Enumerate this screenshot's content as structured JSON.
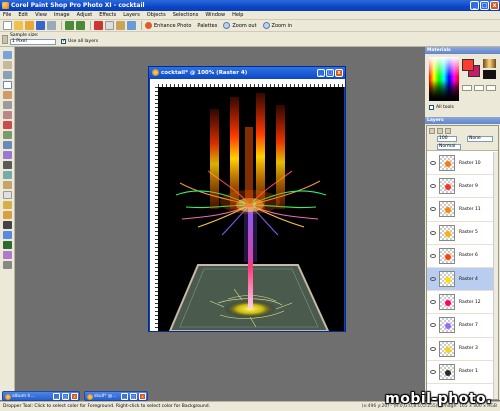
{
  "window": {
    "title": "Corel Paint Shop Pro Photo XI - cocktail",
    "min": "_",
    "max": "□",
    "close": "x"
  },
  "menu": [
    "File",
    "Edit",
    "View",
    "Image",
    "Adjust",
    "Effects",
    "Layers",
    "Objects",
    "Selections",
    "Window",
    "Help"
  ],
  "toolbar": {
    "enhance_photo": "Enhance Photo",
    "palettes": "Palettes",
    "zoom_out": "Zoom out",
    "zoom_in": "Zoom in"
  },
  "tool_options": {
    "sample_size_label": "Sample size:",
    "sample_size_value": "1 Pixel",
    "use_all_layers": "Use all layers",
    "use_all_layers_checked": true
  },
  "document": {
    "title": "cocktail* @ 100% (Raster 4)"
  },
  "materials": {
    "title": "Materials",
    "all_tools": "All tools",
    "foreground": "#ff3b2f",
    "background": "#cc1a6a"
  },
  "layers": {
    "title": "Layers",
    "opacity": "100",
    "blend_mode": "Normal",
    "none": "None",
    "items": [
      {
        "name": "Raster 10",
        "color": "#ff7a00",
        "selected": false
      },
      {
        "name": "Raster 9",
        "color": "#ff2d2d",
        "selected": false
      },
      {
        "name": "Raster 11",
        "color": "#ff8800",
        "selected": false
      },
      {
        "name": "Raster 5",
        "color": "#ffb000",
        "selected": false
      },
      {
        "name": "Raster 6",
        "color": "#ff4400",
        "selected": false
      },
      {
        "name": "Raster 4",
        "color": "#ffe000",
        "selected": true
      },
      {
        "name": "Raster 12",
        "color": "#ff0066",
        "selected": false
      },
      {
        "name": "Raster 7",
        "color": "#9966ff",
        "selected": false
      },
      {
        "name": "Raster 3",
        "color": "#ffd400",
        "selected": false
      },
      {
        "name": "Raster 1",
        "color": "#2a2a2a",
        "selected": false
      }
    ]
  },
  "minimized": [
    {
      "title": "album h..."
    },
    {
      "title": "skull* @..."
    }
  ],
  "status": {
    "left": "Dropper Tool: Click to select color for Foreground. Right-click to select color for Background.",
    "right": "(x:496 y:20) - (R:0,G:0,B:0,O:255) - Image: 165 x 300 x RGB"
  },
  "watermark": "mobil-photo."
}
